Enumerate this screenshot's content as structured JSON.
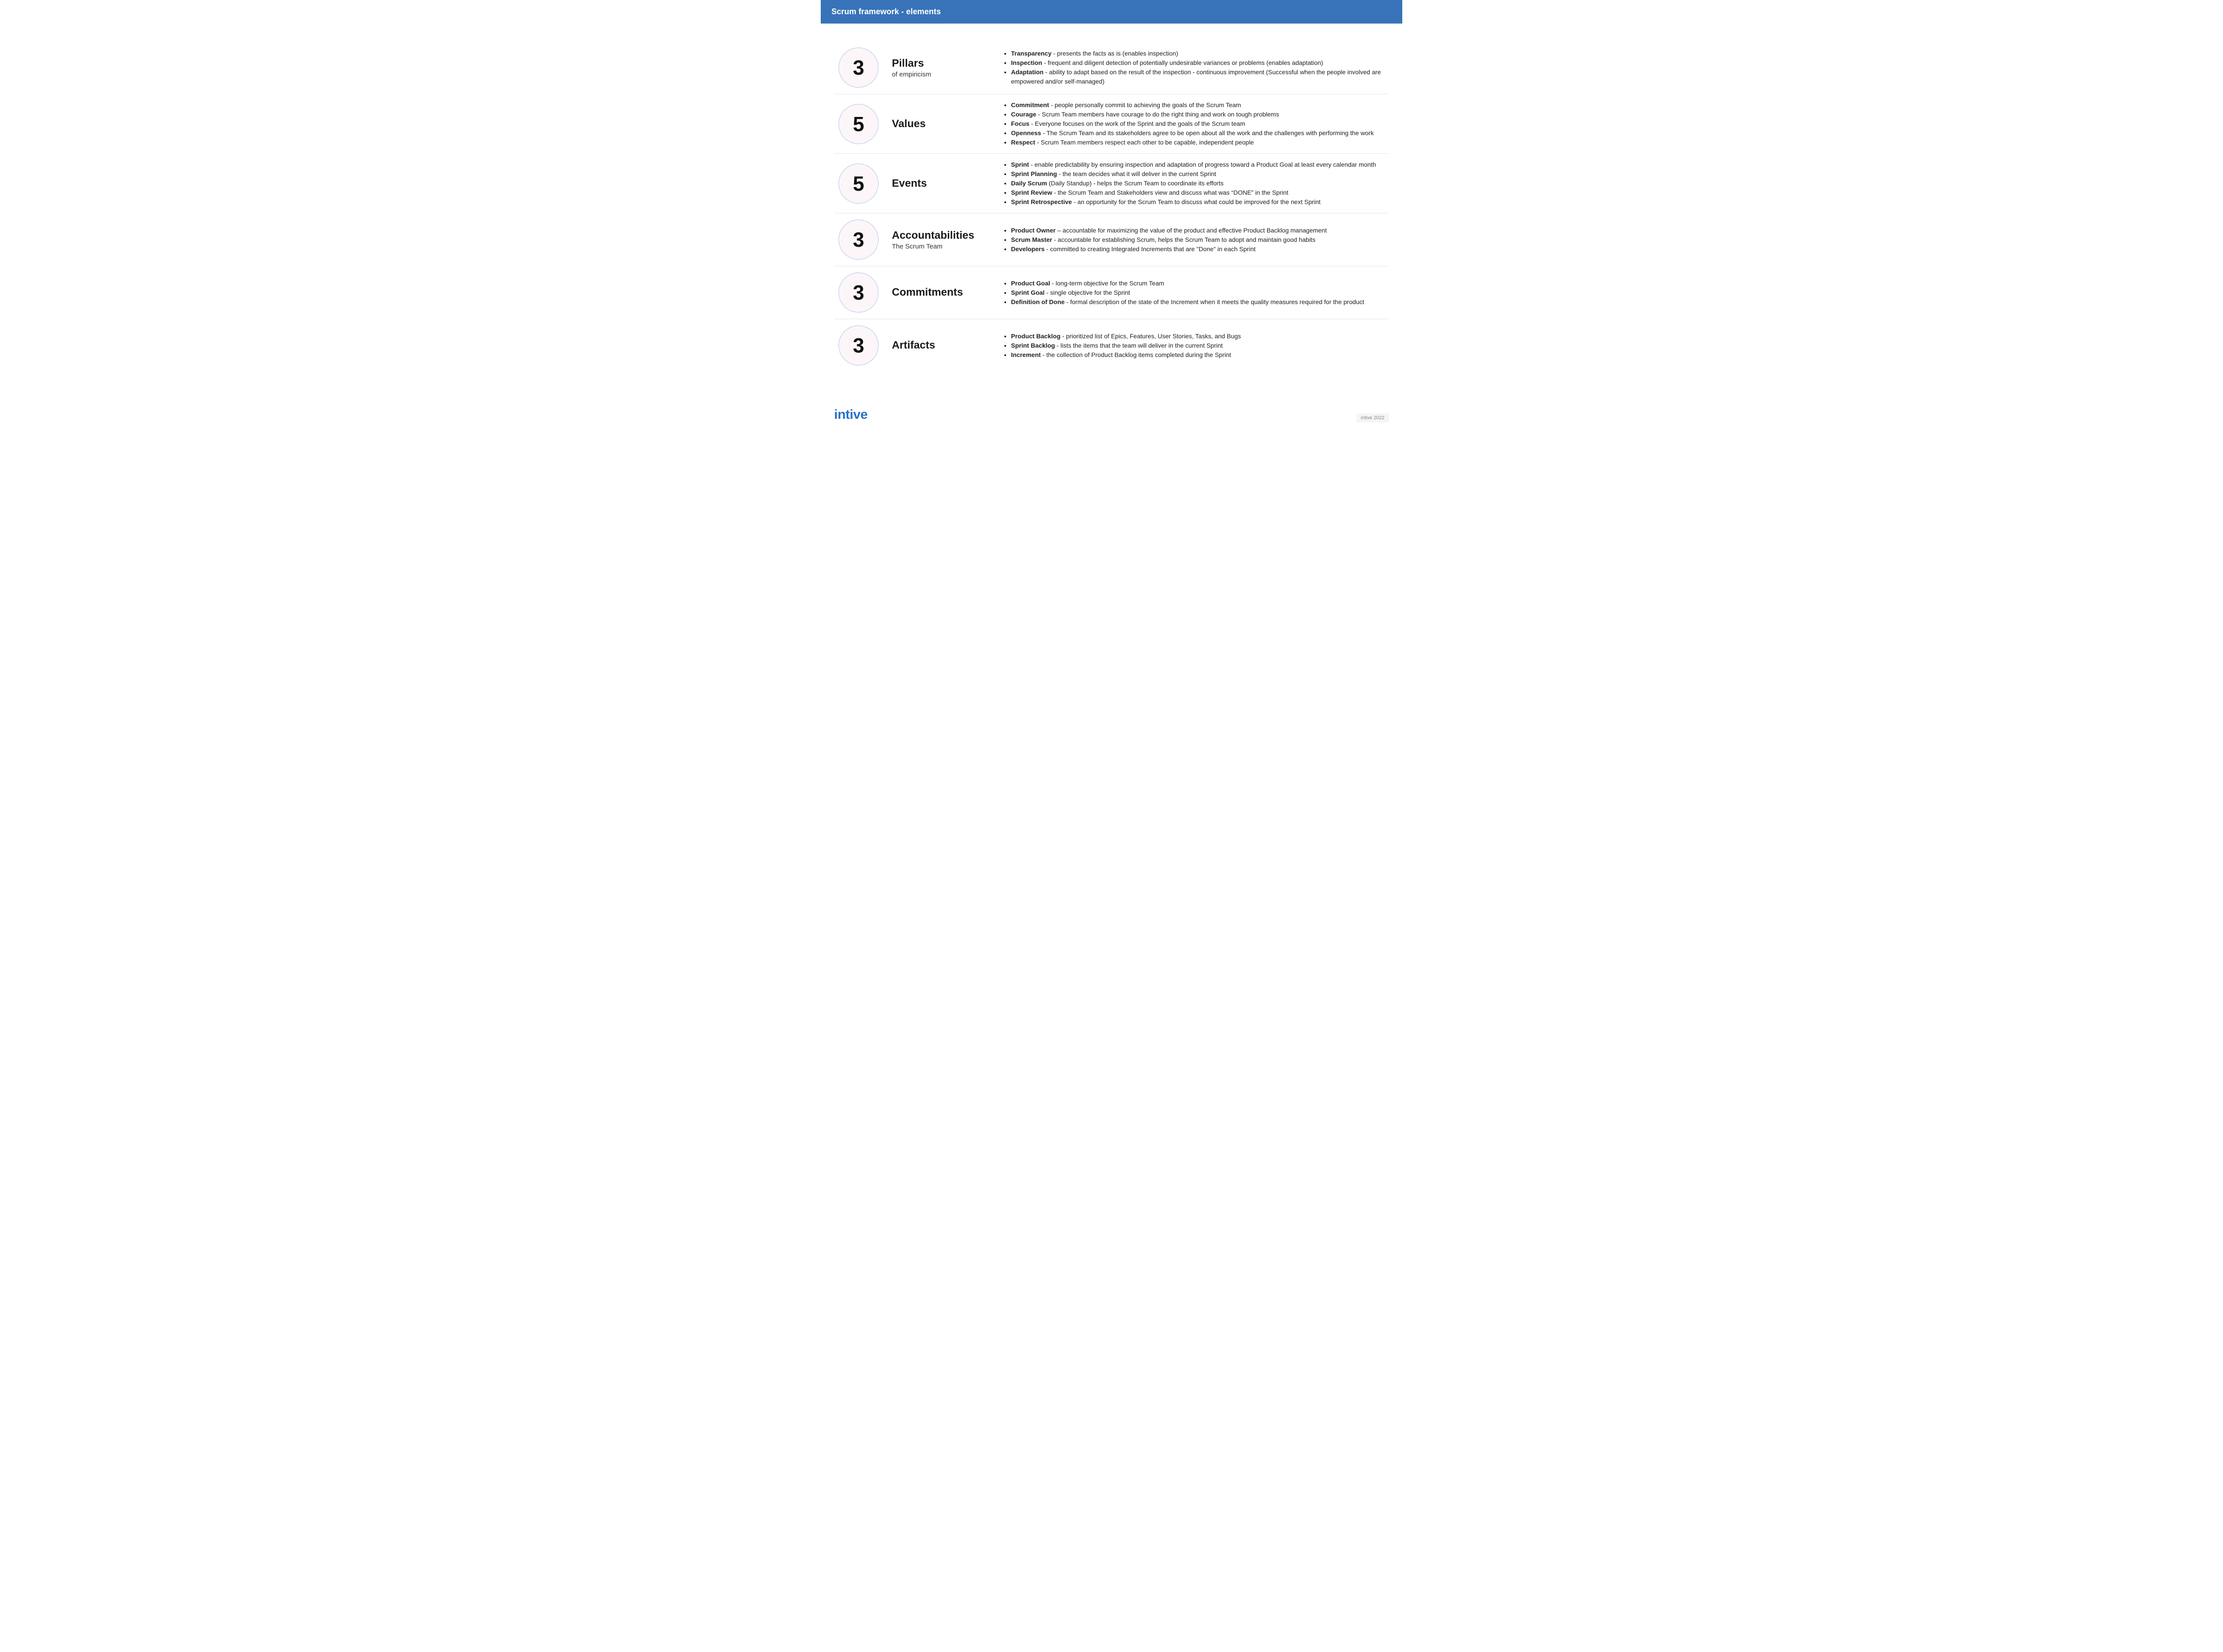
{
  "header": {
    "title": "Scrum framework - elements"
  },
  "sections": [
    {
      "count": "3",
      "title": "Pillars",
      "subtitle": "of empiricism",
      "items": [
        {
          "term": "Transparency",
          "desc": " - presents the facts as is (enables inspection)"
        },
        {
          "term": "Inspection",
          "desc": " - frequent and diligent detection of potentially undesirable variances or problems (enables adaptation)"
        },
        {
          "term": "Adaptation",
          "desc": " - ability to adapt based on the result of the inspection - continuous improvement (Successful when the people involved are empowered and/or self-managed)"
        }
      ]
    },
    {
      "count": "5",
      "title": "Values",
      "subtitle": "",
      "items": [
        {
          "term": "Commitment",
          "desc": " - people personally commit to achieving the goals of the Scrum Team"
        },
        {
          "term": "Courage",
          "desc": " - Scrum Team members have courage to do the right thing and work on tough problems"
        },
        {
          "term": "Focus",
          "desc": " - Everyone focuses on the work of the Sprint and the goals of the Scrum team"
        },
        {
          "term": "Openness",
          "desc": " - The Scrum Team and its stakeholders agree to be open about all the work and the challenges with performing the work"
        },
        {
          "term": "Respect",
          "desc": " - Scrum Team members respect each other to be capable, independent people"
        }
      ]
    },
    {
      "count": "5",
      "title": "Events",
      "subtitle": "",
      "items": [
        {
          "term": "Sprint",
          "desc": " - enable predictability by ensuring inspection and adaptation of progress toward a Product Goal at least every calendar month"
        },
        {
          "term": "Sprint Planning",
          "desc": " - the team decides what it will deliver in the current Sprint"
        },
        {
          "term": "Daily Scrum",
          "note": " (Daily Standup) - ",
          "desc": " helps the Scrum Team to coordinate its efforts"
        },
        {
          "term": "Sprint Review",
          "desc": " - the Scrum Team and Stakeholders view and discuss what was “DONE” in the Sprint"
        },
        {
          "term": "Sprint Retrospective",
          "desc": " - an opportunity for the Scrum Team to discuss what could be improved for the next Sprint"
        }
      ]
    },
    {
      "count": "3",
      "title": "Accountabilities",
      "subtitle": "The Scrum Team",
      "items": [
        {
          "term": "Product Owner",
          "desc": " – accountable for maximizing the value of the product and effective Product Backlog management"
        },
        {
          "term": "Scrum Master",
          "desc": " - accountable for establishing Scrum, helps the Scrum Team to adopt and maintain good habits"
        },
        {
          "term": "Developers",
          "desc": " - committed to creating Integrated Increments that are \"Done\" in each Sprint"
        }
      ]
    },
    {
      "count": "3",
      "title": "Commitments",
      "subtitle": "",
      "items": [
        {
          "term": "Product Goal",
          "desc": " - long-term objective for the Scrum Team"
        },
        {
          "term": "Sprint Goal",
          "desc": " - single objective for the Sprint"
        },
        {
          "term": "Definition of Done",
          "desc": " - formal description of the state of the Increment when it meets the quality measures required for the product"
        }
      ]
    },
    {
      "count": "3",
      "title": "Artifacts",
      "subtitle": "",
      "items": [
        {
          "term": "Product Backlog",
          "desc": " - prioritized list of Epics, Features, User Stories, Tasks, and Bugs"
        },
        {
          "term": "Sprint Backlog",
          "desc": " - lists the items that the team will deliver in the current Sprint"
        },
        {
          "term": "Increment",
          "desc": " - the collection of Product Backlog items completed during the Sprint"
        }
      ]
    }
  ],
  "footer": {
    "logo": "intive",
    "copyright": "intive 2022"
  }
}
